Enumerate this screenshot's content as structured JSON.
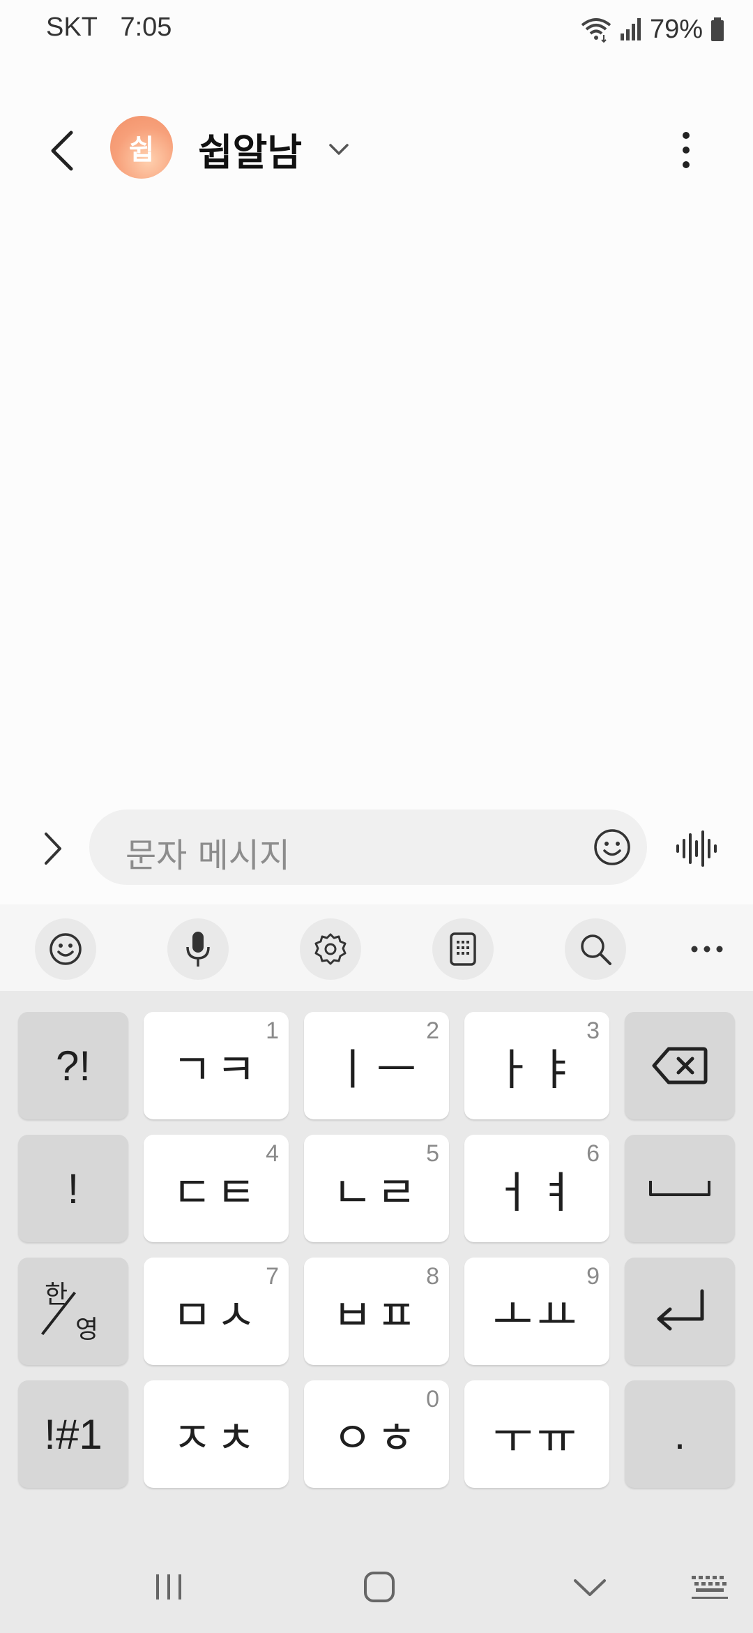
{
  "status_bar": {
    "carrier": "SKT",
    "time": "7:05",
    "battery": "79%"
  },
  "header": {
    "avatar_initial": "쉽",
    "contact_name": "쉽알남"
  },
  "composer": {
    "placeholder": "문자 메시지"
  },
  "keyboard": {
    "keys": [
      {
        "id": "key-punct",
        "main": "?!",
        "num": ""
      },
      {
        "id": "key-1",
        "main": "ㄱㅋ",
        "num": "1"
      },
      {
        "id": "key-2",
        "main": "ㅣㅡ",
        "num": "2"
      },
      {
        "id": "key-3",
        "main": "ㅏㅑ",
        "num": "3"
      },
      {
        "id": "key-exclaim",
        "main": "!",
        "num": ""
      },
      {
        "id": "key-4",
        "main": "ㄷㅌ",
        "num": "4"
      },
      {
        "id": "key-5",
        "main": "ㄴㄹ",
        "num": "5"
      },
      {
        "id": "key-6",
        "main": "ㅓㅕ",
        "num": "6"
      },
      {
        "id": "key-7",
        "main": "ㅁㅅ",
        "num": "7"
      },
      {
        "id": "key-8",
        "main": "ㅂㅍ",
        "num": "8"
      },
      {
        "id": "key-9",
        "main": "ㅗㅛ",
        "num": "9"
      },
      {
        "id": "key-symbols",
        "main": "!#1",
        "num": ""
      },
      {
        "id": "key-jc",
        "main": "ㅈㅊ",
        "num": ""
      },
      {
        "id": "key-0",
        "main": "ㅇㅎ",
        "num": "0"
      },
      {
        "id": "key-u",
        "main": "ㅜㅠ",
        "num": ""
      },
      {
        "id": "key-period",
        "main": ".",
        "num": ""
      }
    ],
    "lang_toggle": {
      "top": "한",
      "bottom": "영"
    }
  },
  "icons": {
    "back": "chevron-left-icon",
    "name_dropdown": "chevron-down-icon",
    "more": "more-vertical-icon",
    "expand": "chevron-right-icon",
    "emoji": "emoji-icon",
    "voice": "voice-wave-icon",
    "toolbar": [
      "emoji-icon",
      "mic-icon",
      "settings-icon",
      "keyboard-mode-icon",
      "search-icon",
      "more-horizontal-icon"
    ],
    "backspace": "backspace-icon",
    "space": "space-icon",
    "enter": "enter-icon",
    "nav": [
      "recents-icon",
      "home-icon",
      "back-down-icon",
      "keyboard-switch-icon"
    ]
  },
  "colors": {
    "avatar_gradient_start": "#ffd1b0",
    "avatar_gradient_end": "#f19068",
    "keyboard_bg": "#e9e9e9",
    "composer_bg": "#f0f0f0"
  }
}
